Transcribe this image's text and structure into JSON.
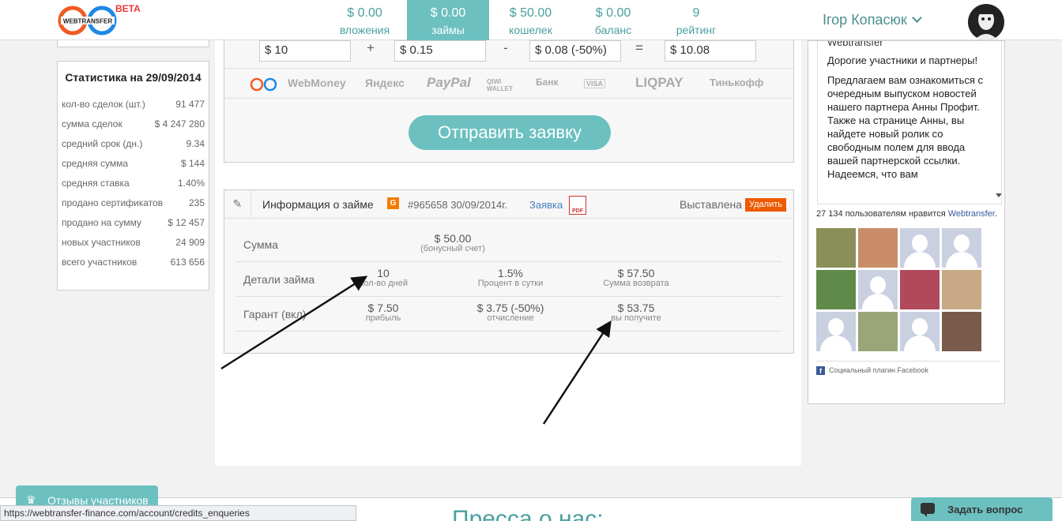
{
  "logo": {
    "text": "WEBTRANSFER",
    "beta": "BETA"
  },
  "header": {
    "stats": [
      {
        "value": "$ 0.00",
        "label": "вложения",
        "active": false
      },
      {
        "value": "$ 0.00",
        "label": "займы",
        "active": true
      },
      {
        "value": "$ 50.00",
        "label": "кошелек",
        "active": false
      },
      {
        "value": "$ 0.00",
        "label": "баланс",
        "active": false
      },
      {
        "value": "9",
        "label": "рейтинг",
        "active": false
      }
    ],
    "username": "Ігор Копасюк"
  },
  "stats_panel": {
    "title": "Статистика на 29/09/2014",
    "rows": [
      {
        "label": "кол-во сделок (шт.)",
        "value": "91 477"
      },
      {
        "label": "сумма сделок",
        "value": "$ 4 247 280"
      },
      {
        "label": "средний срок (дн.)",
        "value": "9.34"
      },
      {
        "label": "средняя сумма",
        "value": "$ 144"
      },
      {
        "label": "средняя ставка",
        "value": "1.40%"
      },
      {
        "label": "продано сертификатов",
        "value": "235"
      },
      {
        "label": "продано на сумму",
        "value": "$ 12 457"
      },
      {
        "label": "новых участников",
        "value": "24 909"
      },
      {
        "label": "всего участников",
        "value": "613 656"
      }
    ]
  },
  "calculator": {
    "amount": "$ 10",
    "op1": "+",
    "fee": "$ 0.15",
    "op2": "-",
    "discount": "$ 0.08 (-50%)",
    "op3": "=",
    "total": "$ 10.08",
    "payment_methods": [
      "WebMoney",
      "Яндекс",
      "PayPal",
      "QIWI WALLET",
      "Банк",
      "VISA",
      "LIQPAY",
      "Тинькофф"
    ],
    "submit_label": "Отправить заявку"
  },
  "loan_info": {
    "title": "Информация о займе",
    "g_badge": "G",
    "number": "#965658 30/09/2014г.",
    "link": "Заявка",
    "pdf": "PDF",
    "status": "Выставлена",
    "delete_label": "Удалить",
    "rows": [
      {
        "label": "Сумма",
        "cells": [
          {
            "value": "$ 50.00",
            "sub": "(бонусный счет)"
          }
        ]
      },
      {
        "label": "Детали займа",
        "cells": [
          {
            "value": "10",
            "sub": "Кол-во дней"
          },
          {
            "value": "1.5%",
            "sub": "Процент в сутки"
          },
          {
            "value": "$ 57.50",
            "sub": "Сумма возврата"
          }
        ]
      },
      {
        "label": "Гарант (вкл)",
        "cells": [
          {
            "value": "$ 7.50",
            "sub": "прибыль"
          },
          {
            "value": "$ 3.75 (-50%)",
            "sub": "отчисление"
          },
          {
            "value": "$ 53.75",
            "sub": "вы получите"
          }
        ]
      }
    ]
  },
  "news": {
    "title": "Webtransfer",
    "paragraphs": [
      "Дорогие участники и партнеры!",
      "Предлагаем вам ознакомиться с очередным выпуском новостей нашего партнера Анны Профит. Также на странице Анны, вы найдете новый ролик со свободным полем для ввода вашей партнерской ссылки. Надеемся, что вам"
    ]
  },
  "facebook": {
    "likes_prefix": "27 134 пользователям нравится",
    "likes_link": "Webtransfer",
    "likes_suffix": ".",
    "plugin_label": "Социальный плагин Facebook"
  },
  "footer": {
    "press_title": "Пресса о нас:",
    "reviews_label": "Отзывы участников",
    "ask_label": "Задать вопрос",
    "status_url": "https://webtransfer-finance.com/account/credits_enqueries"
  }
}
